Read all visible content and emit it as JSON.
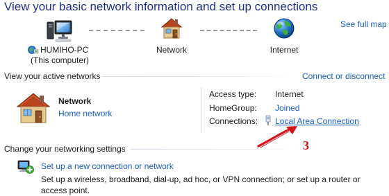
{
  "header": {
    "title": "View your basic network information and set up connections",
    "see_full_map": "See full map"
  },
  "network_map": {
    "computer": {
      "icon": "computer-icon",
      "name": "HUMIHO-PC",
      "subtitle": "(This computer)"
    },
    "network": {
      "icon": "house-icon",
      "name": "Network"
    },
    "internet": {
      "icon": "globe-icon",
      "name": "Internet"
    }
  },
  "active_networks": {
    "heading": "View your active networks",
    "connect_link": "Connect or disconnect",
    "network_name": "Network",
    "network_type": "Home network",
    "access_type_label": "Access type:",
    "access_type_value": "Internet",
    "homegroup_label": "HomeGroup:",
    "homegroup_value": "Joined",
    "connections_label": "Connections:",
    "connections_value": "Local Area Connection",
    "annotation_number": "3"
  },
  "settings": {
    "heading": "Change your networking settings",
    "task_title": "Set up a new connection or network",
    "task_description": "Set up a wireless, broadband, dial-up, ad hoc, or VPN connection; or set up a router or access point."
  },
  "colors": {
    "title": "#1e3287",
    "link": "#1a5ec8",
    "annotation": "#d4141a"
  }
}
